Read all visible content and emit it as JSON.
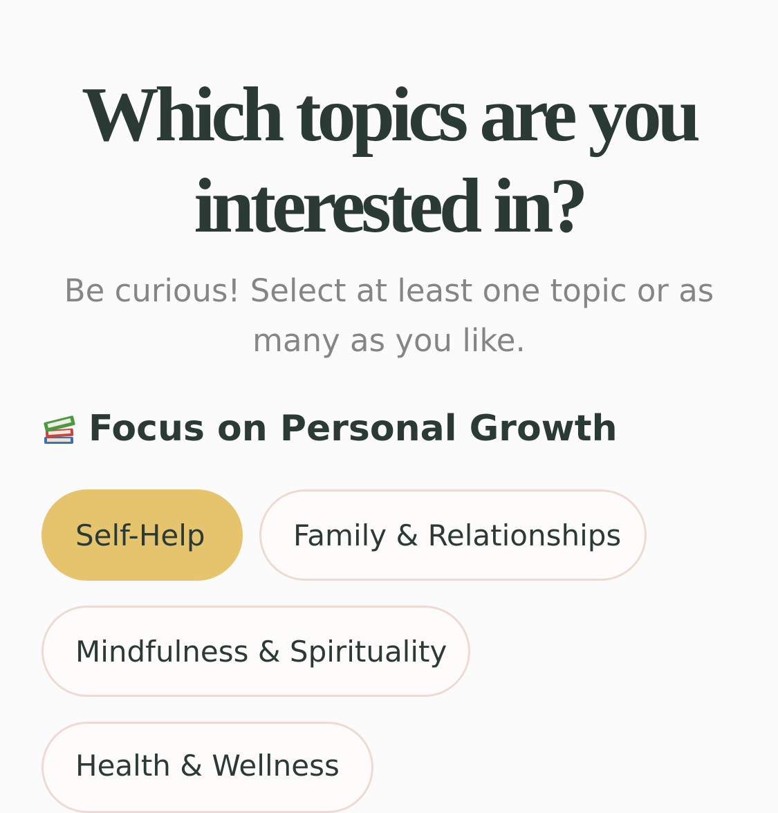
{
  "page": {
    "title_line1": "Which topics are you",
    "title_line2": "interested in?",
    "subtitle": "Be curious! Select at least one topic or as many as you like."
  },
  "section": {
    "icon": "books-icon",
    "heading": "Focus on Personal Growth"
  },
  "topics": [
    {
      "label": "Self-Help",
      "selected": true
    },
    {
      "label": "Family & Relationships",
      "selected": false
    },
    {
      "label": "Mindfulness & Spirituality",
      "selected": false
    },
    {
      "label": "Health & Wellness",
      "selected": false
    }
  ],
  "colors": {
    "selected_chip": "#e6c46d",
    "chip_border": "#efd9d3",
    "text_dark": "#2b3a35",
    "text_muted": "#858585",
    "background": "#fbfbfb"
  }
}
